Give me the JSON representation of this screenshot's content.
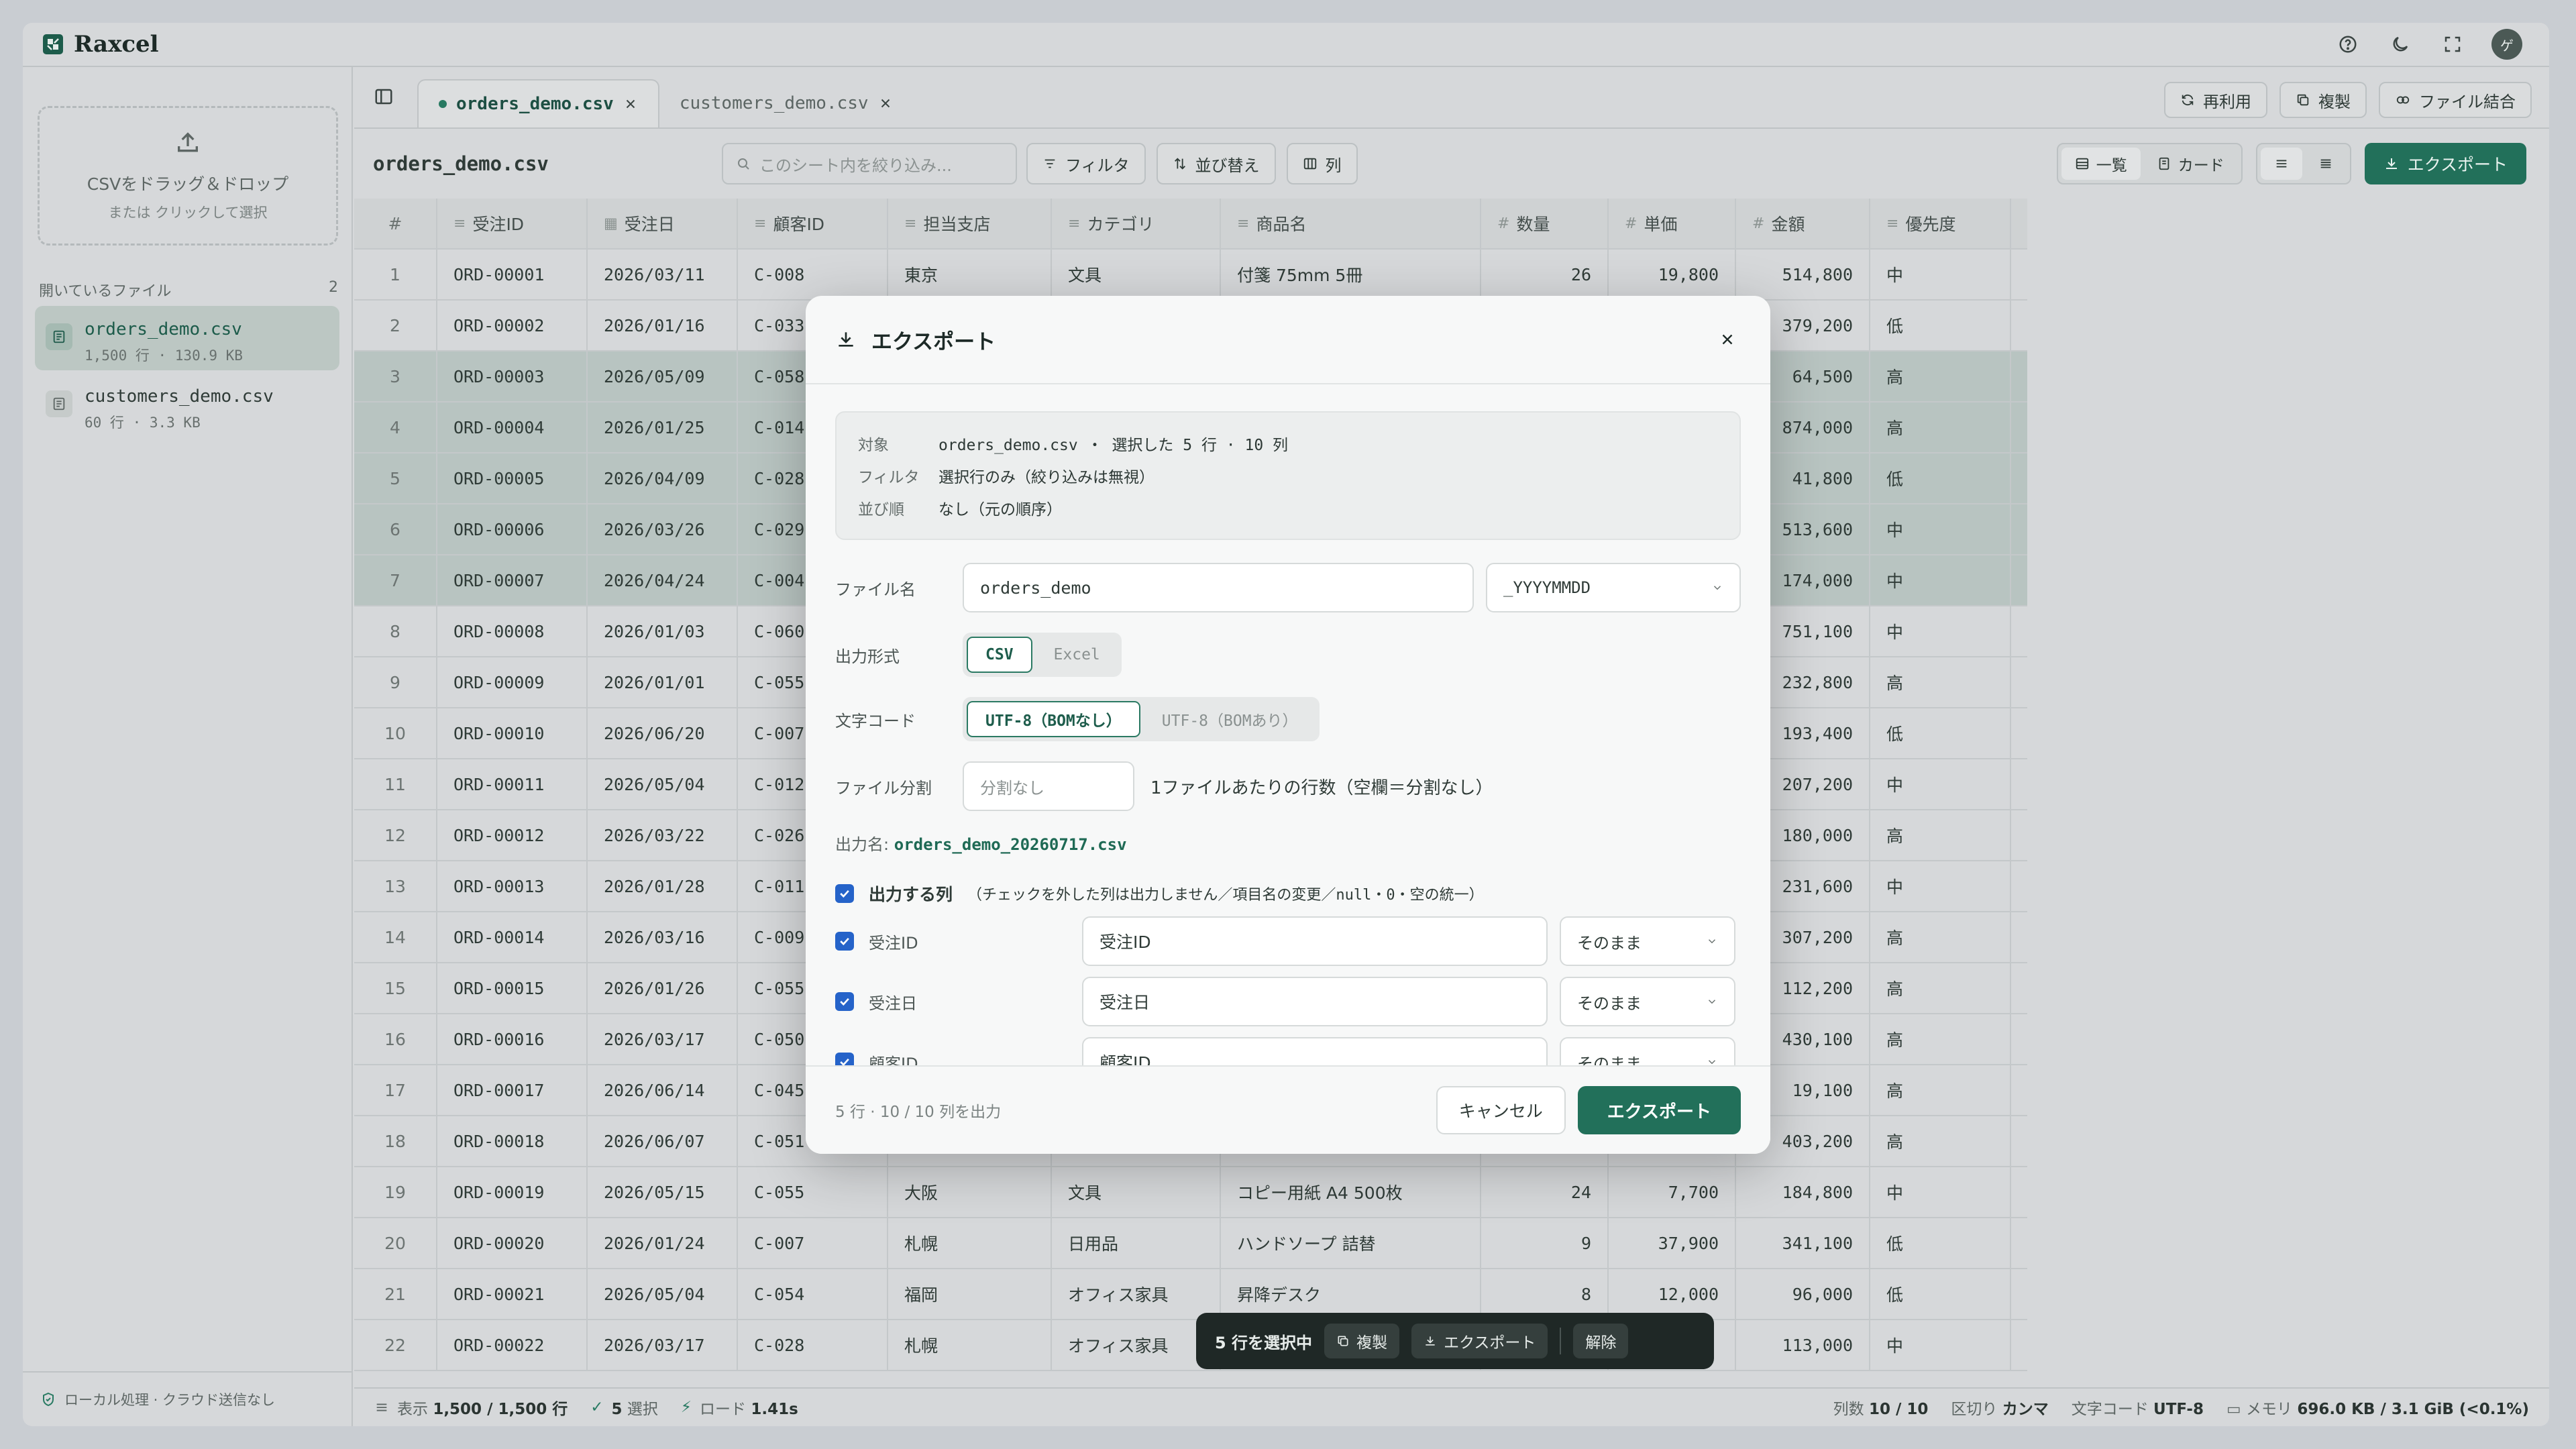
{
  "app": {
    "name": "Raxcel"
  },
  "sidebar": {
    "drop_title": "CSVをドラッグ＆ドロップ",
    "drop_sub": "または クリックして選択",
    "files_header": "開いているファイル",
    "files_count": "2",
    "files": [
      {
        "name": "orders_demo.csv",
        "meta": "1,500 行 · 130.9 KB"
      },
      {
        "name": "customers_demo.csv",
        "meta": "60 行 · 3.3 KB"
      }
    ],
    "footer": "ローカル処理 · クラウド送信なし"
  },
  "tabs": [
    {
      "label": "orders_demo.csv"
    },
    {
      "label": "customers_demo.csv"
    }
  ],
  "tab_actions": {
    "reuse": "再利用",
    "duplicate": "複製",
    "merge": "ファイル結合"
  },
  "toolbar": {
    "sheet_name": "orders_demo.csv",
    "search_placeholder": "このシート内を絞り込み...",
    "filter": "フィルタ",
    "sort": "並び替え",
    "columns": "列",
    "view_list": "一覧",
    "view_card": "カード",
    "export": "エクスポート"
  },
  "table": {
    "headers": [
      "#",
      "受注ID",
      "受注日",
      "顧客ID",
      "担当支店",
      "カテゴリ",
      "商品名",
      "数量",
      "単価",
      "金額",
      "優先度"
    ],
    "rows": [
      [
        "1",
        "ORD-00001",
        "2026/03/11",
        "C-008",
        "東京",
        "文具",
        "付箋 75mm 5冊",
        "26",
        "19,800",
        "514,800",
        "中"
      ],
      [
        "2",
        "ORD-00002",
        "2026/01/16",
        "C-033",
        "",
        "",
        "",
        "",
        "",
        "379,200",
        "低"
      ],
      [
        "3",
        "ORD-00003",
        "2026/05/09",
        "C-058",
        "",
        "",
        "",
        "",
        "",
        "64,500",
        "高"
      ],
      [
        "4",
        "ORD-00004",
        "2026/01/25",
        "C-014",
        "",
        "",
        "",
        "",
        "",
        "874,000",
        "高"
      ],
      [
        "5",
        "ORD-00005",
        "2026/04/09",
        "C-028",
        "",
        "",
        "",
        "",
        "",
        "41,800",
        "低"
      ],
      [
        "6",
        "ORD-00006",
        "2026/03/26",
        "C-029",
        "",
        "",
        "",
        "",
        "",
        "513,600",
        "中"
      ],
      [
        "7",
        "ORD-00007",
        "2026/04/24",
        "C-004",
        "",
        "",
        "",
        "",
        "",
        "174,000",
        "中"
      ],
      [
        "8",
        "ORD-00008",
        "2026/01/03",
        "C-060",
        "",
        "",
        "",
        "",
        "",
        "751,100",
        "中"
      ],
      [
        "9",
        "ORD-00009",
        "2026/01/01",
        "C-055",
        "",
        "",
        "",
        "",
        "",
        "232,800",
        "高"
      ],
      [
        "10",
        "ORD-00010",
        "2026/06/20",
        "C-007",
        "",
        "",
        "",
        "",
        "",
        "193,400",
        "低"
      ],
      [
        "11",
        "ORD-00011",
        "2026/05/04",
        "C-012",
        "",
        "",
        "",
        "",
        "",
        "207,200",
        "中"
      ],
      [
        "12",
        "ORD-00012",
        "2026/03/22",
        "C-026",
        "",
        "",
        "",
        "",
        "",
        "180,000",
        "高"
      ],
      [
        "13",
        "ORD-00013",
        "2026/01/28",
        "C-011",
        "",
        "",
        "",
        "",
        "",
        "231,600",
        "中"
      ],
      [
        "14",
        "ORD-00014",
        "2026/03/16",
        "C-009",
        "",
        "",
        "",
        "",
        "",
        "307,200",
        "高"
      ],
      [
        "15",
        "ORD-00015",
        "2026/01/26",
        "C-055",
        "",
        "",
        "",
        "",
        "",
        "112,200",
        "高"
      ],
      [
        "16",
        "ORD-00016",
        "2026/03/17",
        "C-050",
        "",
        "",
        "",
        "",
        "",
        "430,100",
        "高"
      ],
      [
        "17",
        "ORD-00017",
        "2026/06/14",
        "C-045",
        "",
        "",
        "",
        "",
        "",
        "19,100",
        "高"
      ],
      [
        "18",
        "ORD-00018",
        "2026/06/07",
        "C-051",
        "",
        "",
        "",
        "",
        "",
        "403,200",
        "高"
      ],
      [
        "19",
        "ORD-00019",
        "2026/05/15",
        "C-055",
        "大阪",
        "文具",
        "コピー用紙 A4 500枚",
        "24",
        "7,700",
        "184,800",
        "中"
      ],
      [
        "20",
        "ORD-00020",
        "2026/01/24",
        "C-007",
        "札幌",
        "日用品",
        "ハンドソープ 詰替",
        "9",
        "37,900",
        "341,100",
        "低"
      ],
      [
        "21",
        "ORD-00021",
        "2026/05/04",
        "C-054",
        "福岡",
        "オフィス家具",
        "昇降デスク",
        "8",
        "12,000",
        "96,000",
        "低"
      ],
      [
        "22",
        "ORD-00022",
        "2026/03/17",
        "C-028",
        "札幌",
        "オフィス家具",
        "",
        "",
        "",
        "113,000",
        "中"
      ]
    ]
  },
  "statusbar": {
    "shown_label": "表示",
    "shown_value": "1,500 / 1,500 行",
    "selected_value": "5",
    "selected_label": "選択",
    "load_label": "ロード",
    "load_value": "1.41s",
    "cols_label": "列数",
    "cols_value": "10 / 10",
    "delim_label": "区切り",
    "delim_value": "カンマ",
    "enc_label": "文字コード",
    "enc_value": "UTF-8",
    "mem_label": "メモリ",
    "mem_value": "696.0 KB / 3.1 GiB (<0.1%)"
  },
  "selection_bar": {
    "label": "5 行を選択中",
    "copy": "複製",
    "export": "エクスポート",
    "clear": "解除"
  },
  "modal": {
    "title": "エクスポート",
    "info": [
      {
        "key": "対象",
        "value": "orders_demo.csv ・ 選択した 5 行 · 10 列"
      },
      {
        "key": "フィルタ",
        "value": "選択行のみ（絞り込みは無視）"
      },
      {
        "key": "並び順",
        "value": "なし（元の順序）"
      }
    ],
    "filename_label": "ファイル名",
    "filename_value": "orders_demo",
    "suffix_value": "_YYYYMMDD",
    "format_label": "出力形式",
    "format_options": [
      "CSV",
      "Excel"
    ],
    "encoding_label": "文字コード",
    "encoding_options": [
      "UTF-8（BOMなし）",
      "UTF-8（BOMあり）"
    ],
    "split_label": "ファイル分割",
    "split_placeholder": "分割なし",
    "split_hint": "1ファイルあたりの行数（空欄＝分割なし）",
    "output_prefix": "出力名:",
    "output_name": "orders_demo_20260717.csv",
    "columns_title": "出力する列",
    "columns_hint": "（チェックを外した列は出力しません／項目名の変更／null・0・空の統一）",
    "columns": [
      {
        "name": "受注ID",
        "rename": "受注ID",
        "mode": "そのまま"
      },
      {
        "name": "受注日",
        "rename": "受注日",
        "mode": "そのまま"
      },
      {
        "name": "顧客ID",
        "rename": "顧客ID",
        "mode": "そのまま"
      }
    ],
    "footer_text": "5 行 · 10 / 10 列を出力",
    "cancel": "キャンセル",
    "export": "エクスポート"
  },
  "colors": {
    "accent": "#22705a",
    "checkbox": "#2563c9",
    "selected_row": "#b8c4c1"
  }
}
